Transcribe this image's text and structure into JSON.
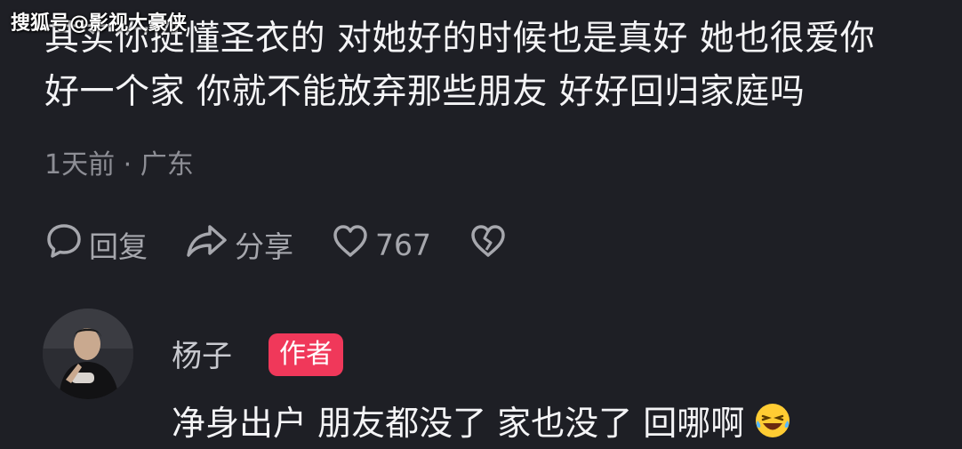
{
  "watermark": "搜狐号@影视大豪侠",
  "comment": {
    "lines": [
      "其实你挺懂圣衣的 对她好的时候也是真好 她也很爱你",
      "好一个家 你就不能放弃那些朋友 好好回归家庭吗"
    ],
    "meta": "1天前 · 广东",
    "actions": {
      "reply_label": "回复",
      "share_label": "分享",
      "like_count": "767"
    }
  },
  "reply": {
    "author": "杨子",
    "badge": "作者",
    "text": "净身出户 朋友都没了 家也没了 回哪啊"
  },
  "colors": {
    "background": "#1e1f25",
    "badge": "#f0385a",
    "muted_text": "#8d8e95"
  }
}
